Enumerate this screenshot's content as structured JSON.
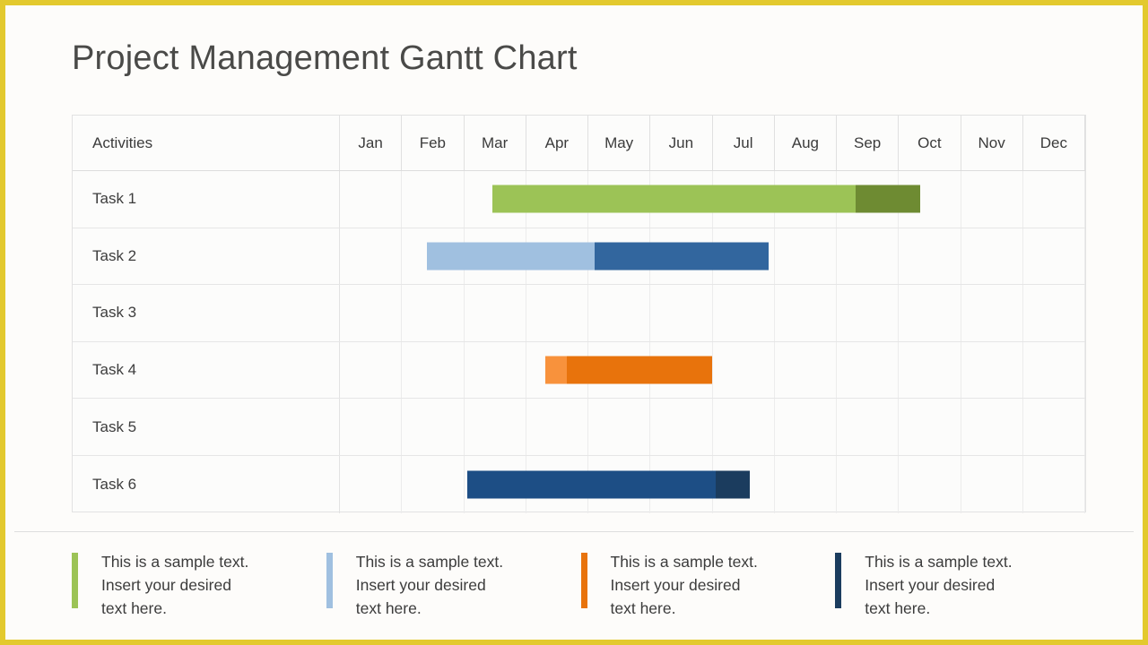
{
  "slide": {
    "title": "Project Management Gantt Chart",
    "border_color": "#e3c92e",
    "background": "#fdfcfa"
  },
  "table": {
    "activities_header": "Activities",
    "months": [
      "Jan",
      "Feb",
      "Mar",
      "Apr",
      "May",
      "Jun",
      "Jul",
      "Aug",
      "Sep",
      "Oct",
      "Nov",
      "Dec"
    ]
  },
  "chart_data": {
    "type": "bar",
    "title": "Project Management Gantt Chart",
    "xlabel": "",
    "ylabel": "Activities",
    "categories": [
      "Jan",
      "Feb",
      "Mar",
      "Apr",
      "May",
      "Jun",
      "Jul",
      "Aug",
      "Sep",
      "Oct",
      "Nov",
      "Dec"
    ],
    "grid": true,
    "legend_position": "bottom",
    "tasks": [
      {
        "label": "Task 1",
        "has_bar": true,
        "start_month": 2.45,
        "end_month": 9.35,
        "segments": [
          {
            "name": "progress",
            "start_month": 2.45,
            "end_month": 8.3,
            "color": "#9cc356"
          },
          {
            "name": "remaining",
            "start_month": 8.3,
            "end_month": 9.35,
            "color": "#6e8b32"
          }
        ]
      },
      {
        "label": "Task 2",
        "has_bar": true,
        "start_month": 1.4,
        "end_month": 6.9,
        "segments": [
          {
            "name": "progress",
            "start_month": 1.4,
            "end_month": 4.1,
            "color": "#a0c0e0"
          },
          {
            "name": "remaining",
            "start_month": 4.1,
            "end_month": 6.9,
            "color": "#32669e"
          }
        ]
      },
      {
        "label": "Task 3",
        "has_bar": false,
        "segments": []
      },
      {
        "label": "Task 4",
        "has_bar": true,
        "start_month": 3.3,
        "end_month": 6.0,
        "segments": [
          {
            "name": "progress",
            "start_month": 3.3,
            "end_month": 3.65,
            "color": "#f8923c"
          },
          {
            "name": "remaining",
            "start_month": 3.65,
            "end_month": 6.0,
            "color": "#e8730c"
          }
        ]
      },
      {
        "label": "Task 5",
        "has_bar": false,
        "segments": []
      },
      {
        "label": "Task 6",
        "has_bar": true,
        "start_month": 2.05,
        "end_month": 6.6,
        "segments": [
          {
            "name": "progress",
            "start_month": 2.05,
            "end_month": 6.05,
            "color": "#1d4e85"
          },
          {
            "name": "remaining",
            "start_month": 6.05,
            "end_month": 6.6,
            "color": "#1b3c5e"
          }
        ]
      }
    ],
    "legend": [
      {
        "color": "#9cc356",
        "text": "This is a sample text.\nInsert your desired\ntext here."
      },
      {
        "color": "#a0c0e0",
        "text": "This is a sample text.\nInsert your desired\ntext here."
      },
      {
        "color": "#e8730c",
        "text": "This is a sample text.\nInsert your desired\ntext here."
      },
      {
        "color": "#1b3c5e",
        "text": "This is a sample text.\nInsert your desired\ntext here."
      }
    ]
  }
}
